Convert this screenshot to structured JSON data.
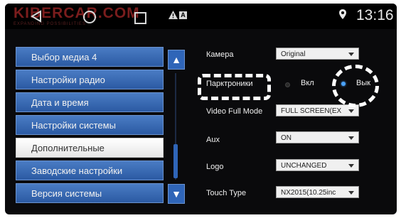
{
  "watermark": {
    "brand": "KIBERCAR.COM",
    "tagline": "EXPANDING POSSIBILITIES"
  },
  "status": {
    "time": "13:16",
    "badge": "A"
  },
  "menu": [
    {
      "label": "Выбор медиа 4"
    },
    {
      "label": "Настройки радио"
    },
    {
      "label": "Дата и время"
    },
    {
      "label": "Настройки системы"
    },
    {
      "label": "Дополнительные"
    },
    {
      "label": "Заводские настройки"
    },
    {
      "label": "Версия системы"
    }
  ],
  "scroll": {
    "up_icon": "▲",
    "down_icon": "▼"
  },
  "settings": {
    "camera": {
      "label": "Камера",
      "value": "Original"
    },
    "parking": {
      "label": "Парктроники",
      "on_label": "Вкл",
      "off_label": "Вык",
      "selected": "off"
    },
    "video": {
      "label": "Video Full Mode",
      "value": "FULL SCREEN(EX"
    },
    "aux": {
      "label": "Aux",
      "value": "ON"
    },
    "logo": {
      "label": "Logo",
      "value": "UNCHANGED"
    },
    "touch": {
      "label": "Touch Type",
      "value": "NX2015(10.25inc"
    }
  },
  "colors": {
    "menu_blue": "#2b5aa3",
    "screen_bg": "#0a0a0c",
    "radio_active": "#4ba3ff",
    "brand_red": "#7a1d1d"
  }
}
